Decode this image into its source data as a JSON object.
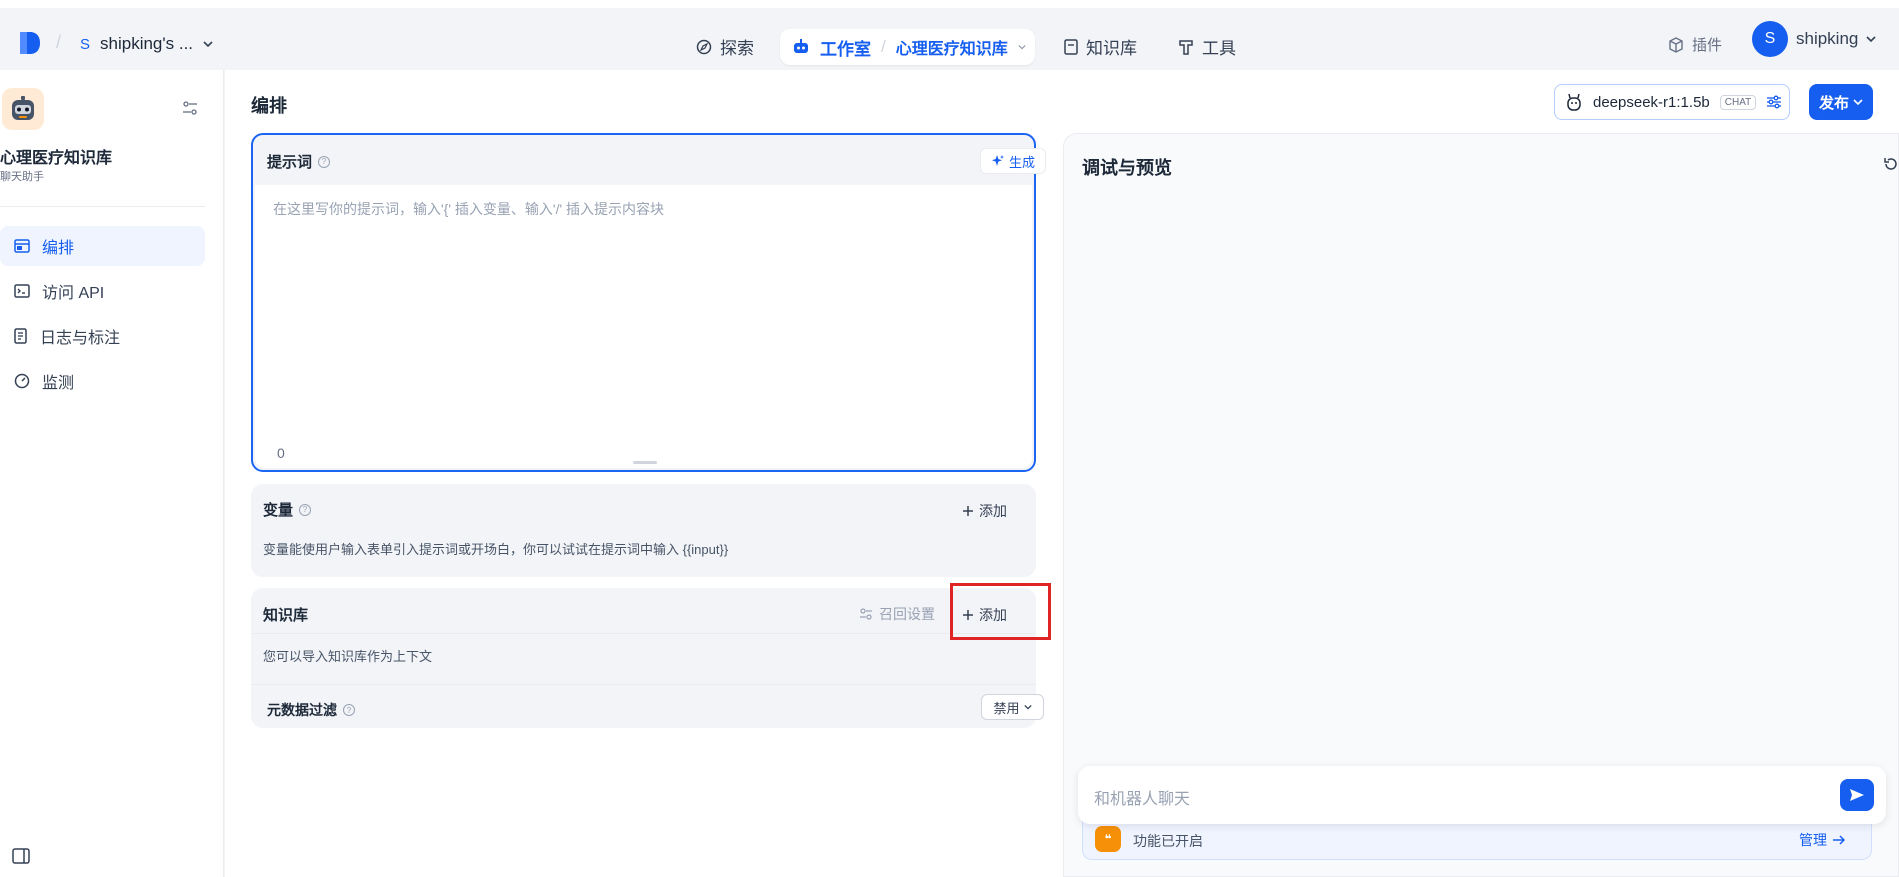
{
  "topbar": {
    "workspace_letter": "S",
    "workspace_name": "shipking's ...",
    "nav_explore": "探索",
    "nav_studio": "工作室",
    "nav_app": "心理医疗知识库",
    "nav_knowledge": "知识库",
    "nav_tools": "工具",
    "plugins": "插件",
    "user_initial": "S",
    "user_name": "shipking"
  },
  "sidebar": {
    "app_name": "心理医疗知识库",
    "app_type": "聊天助手",
    "items": [
      {
        "label": "编排",
        "icon": "layout-icon"
      },
      {
        "label": "访问 API",
        "icon": "terminal-icon"
      },
      {
        "label": "日志与标注",
        "icon": "file-list-icon"
      },
      {
        "label": "监测",
        "icon": "dashboard-icon"
      }
    ]
  },
  "main": {
    "title": "编排",
    "model_name": "deepseek-r1:1.5b",
    "model_tag": "CHAT",
    "publish_label": "发布",
    "prompt": {
      "label": "提示词",
      "generate_label": "生成",
      "placeholder": "在这里写你的提示词，输入'{' 插入变量、输入'/' 插入提示内容块",
      "char_count": "0"
    },
    "variables": {
      "label": "变量",
      "add_label": "添加",
      "description": "变量能使用户输入表单引入提示词或开场白，你可以试试在提示词中输入 {{input}}"
    },
    "knowledge": {
      "label": "知识库",
      "recall_label": "召回设置",
      "add_label": "添加",
      "description": "您可以导入知识库作为上下文",
      "metadata_label": "元数据过滤",
      "metadata_value": "禁用"
    }
  },
  "preview": {
    "title": "调试与预览",
    "chat_placeholder": "和机器人聊天",
    "feature_text": "功能已开启",
    "manage_label": "管理"
  },
  "colors": {
    "accent": "#155eef",
    "highlight": "#e02424",
    "feature_orange": "#f79009"
  }
}
